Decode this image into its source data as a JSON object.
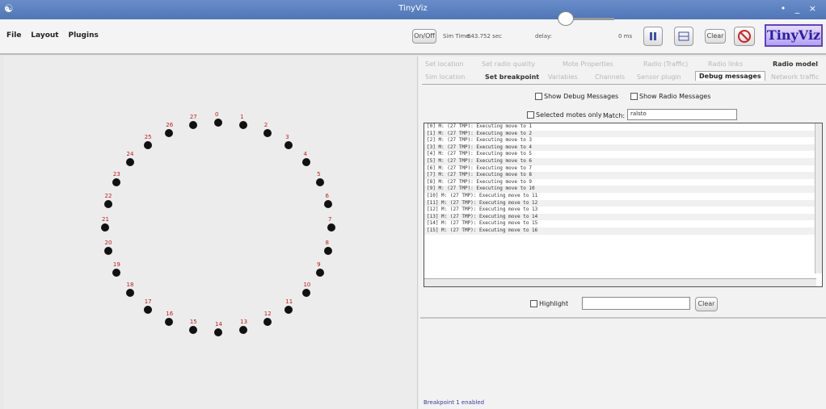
{
  "window": {
    "title": "TinyViz",
    "controls": "• _ ×"
  },
  "menu": [
    "File",
    "Layout",
    "Plugins"
  ],
  "toolbar": {
    "on_off_label": "On/Off",
    "sim_time_label": "Sim Time:",
    "sim_time_value": "643.752 sec",
    "delay_label": "delay:",
    "delay_value": "0 ms",
    "pause_icon": "pause-icon",
    "grid_icon": "grid-icon",
    "clear_label": "Clear",
    "stop_icon": "stop-icon",
    "logo": "TinyViz"
  },
  "tabs": {
    "row1": [
      "Set location",
      "Set radio quality",
      "Mote Properties",
      "Radio (Traffic)",
      "Radio links",
      "Radio model"
    ],
    "row2": [
      "Sim location",
      "Set breakpoint",
      "Variables",
      "Channels",
      "Sensor plugin",
      "Debug messages",
      "Network traffic"
    ],
    "active": "Debug messages"
  },
  "debug": {
    "show_debug_label": "Show Debug Messages",
    "show_radio_label": "Show Radio Messages",
    "selected_only_label": "Selected motes only",
    "match_label": "Match:",
    "match_value": "ralsto",
    "highlight_label": "Highlight",
    "highlight_value": "",
    "clear_label": "Clear"
  },
  "log": [
    "[0] M: (27 TMP): Executing move to 1",
    "[1] M: (27 TMP): Executing move to 2",
    "[2] M: (27 TMP): Executing move to 3",
    "[3] M: (27 TMP): Executing move to 4",
    "[4] M: (27 TMP): Executing move to 5",
    "[5] M: (27 TMP): Executing move to 6",
    "[6] M: (27 TMP): Executing move to 7",
    "[7] M: (27 TMP): Executing move to 8",
    "[8] M: (27 TMP): Executing move to 9",
    "[9] M: (27 TMP): Executing move to 10",
    "[10] M: (27 TMP): Executing move to 11",
    "[11] M: (27 TMP): Executing move to 12",
    "[12] M: (27 TMP): Executing move to 13",
    "[13] M: (27 TMP): Executing move to 14",
    "[14] M: (27 TMP): Executing move to 15",
    "[15] M: (27 TMP): Executing move to 16"
  ],
  "status": "Breakpoint 1 enabled",
  "nodes": [
    "0",
    "1",
    "2",
    "3",
    "4",
    "5",
    "6",
    "7",
    "8",
    "9",
    "10",
    "11",
    "12",
    "13",
    "14",
    "15",
    "16",
    "17",
    "18",
    "19",
    "20",
    "21",
    "22",
    "23",
    "24",
    "25",
    "26",
    "27"
  ]
}
